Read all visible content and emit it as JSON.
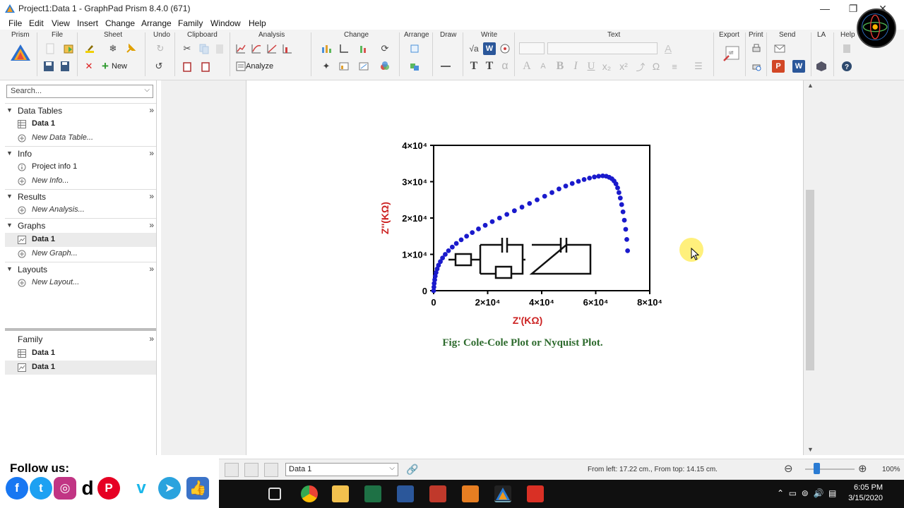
{
  "window": {
    "title": "Project1:Data 1 - GraphPad Prism 8.4.0 (671)",
    "minimize": "—",
    "restore": "❐",
    "close": "✕"
  },
  "menu": [
    "File",
    "Edit",
    "View",
    "Insert",
    "Change",
    "Arrange",
    "Family",
    "Window",
    "Help"
  ],
  "ribbon": {
    "groups": [
      "Prism",
      "File",
      "Sheet",
      "Undo",
      "Clipboard",
      "Analysis",
      "Change",
      "Arrange",
      "Draw",
      "Write",
      "Text",
      "Export",
      "Print",
      "Send",
      "LA",
      "Help"
    ],
    "new_label": "New",
    "analyze_label": "Analyze"
  },
  "navigator": {
    "search_placeholder": "Search...",
    "sections": [
      {
        "label": "Data Tables",
        "items": [
          {
            "label": "Data 1",
            "bold": true
          },
          {
            "label": "New Data Table...",
            "italic": true
          }
        ]
      },
      {
        "label": "Info",
        "items": [
          {
            "label": "Project info 1"
          },
          {
            "label": "New Info...",
            "italic": true
          }
        ]
      },
      {
        "label": "Results",
        "items": [
          {
            "label": "New Analysis...",
            "italic": true
          }
        ]
      },
      {
        "label": "Graphs",
        "items": [
          {
            "label": "Data 1",
            "bold": true,
            "selected": true
          },
          {
            "label": "New Graph...",
            "italic": true
          }
        ]
      },
      {
        "label": "Layouts",
        "items": [
          {
            "label": "New Layout...",
            "italic": true
          }
        ]
      }
    ],
    "family": {
      "label": "Family",
      "items": [
        {
          "label": "Data 1",
          "bold": true
        },
        {
          "label": "Data 1",
          "bold": true,
          "selected": true
        }
      ]
    }
  },
  "chart_data": {
    "type": "scatter",
    "title": "",
    "xlabel": "Z'(KΩ)",
    "ylabel": "Z''(KΩ)",
    "xlim": [
      0,
      80000
    ],
    "ylim": [
      0,
      40000
    ],
    "xticks": [
      "0",
      "2×10⁴",
      "4×10⁴",
      "6×10⁴",
      "8×10⁴"
    ],
    "yticks": [
      "0",
      "1×10⁴",
      "2×10⁴",
      "3×10⁴",
      "4×10⁴"
    ],
    "series": [
      {
        "color": "#1a1acc",
        "x": [
          0,
          100,
          200,
          400,
          600,
          900,
          1300,
          1800,
          2500,
          3300,
          4300,
          5500,
          6900,
          8400,
          10200,
          12200,
          14300,
          16600,
          19100,
          21700,
          24400,
          27100,
          29900,
          32700,
          35500,
          38300,
          41100,
          43800,
          46400,
          48900,
          51300,
          53600,
          55700,
          57700,
          59500,
          61100,
          62600,
          63900,
          65000,
          66000,
          66800,
          67500,
          68100,
          68600,
          69100,
          69600,
          70100,
          70600,
          71100,
          71500,
          71800
        ],
        "y": [
          0,
          1000,
          2000,
          3000,
          4000,
          5000,
          6000,
          7000,
          8000,
          9000,
          10000,
          11000,
          12000,
          13000,
          14000,
          15000,
          16000,
          17000,
          18000,
          19000,
          20000,
          21000,
          22000,
          23000,
          24000,
          25000,
          26000,
          27000,
          28000,
          28800,
          29500,
          30100,
          30600,
          31000,
          31300,
          31500,
          31600,
          31500,
          31200,
          30800,
          30200,
          29400,
          28300,
          27000,
          25500,
          23700,
          21700,
          19400,
          16900,
          14100,
          11000
        ]
      }
    ],
    "grid": false,
    "caption": "Fig: Cole-Cole Plot or Nyquist Plot."
  },
  "status": {
    "sheet": "Data 1",
    "position": "From left: 17.22 cm., From top: 14.15 cm.",
    "zoom": "100%"
  },
  "follow": {
    "label": "Follow us:"
  },
  "clock": {
    "time": "6:05 PM",
    "date": "3/15/2020"
  },
  "colors": {
    "axis_label": "#cc2222",
    "caption": "#2e7d32",
    "data": "#1a1acc"
  }
}
